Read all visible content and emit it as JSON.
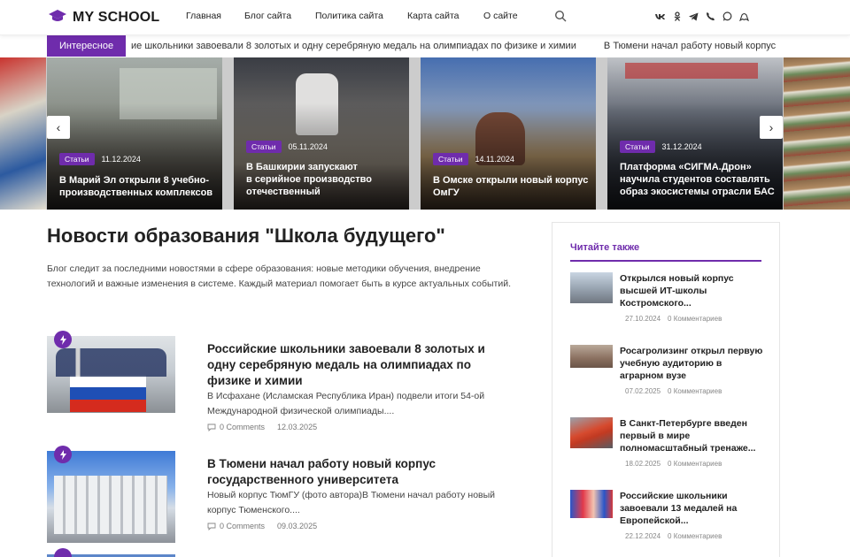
{
  "header": {
    "logo_text": "MY SCHOOL",
    "nav": [
      "Главная",
      "Блог сайта",
      "Политика сайта",
      "Карта сайта",
      "О сайте"
    ],
    "socials": [
      "vk-icon",
      "odnoklassniki-icon",
      "telegram-icon",
      "viber-icon",
      "whatsapp-icon",
      "max-icon"
    ]
  },
  "ticker": {
    "badge": "Интересное",
    "items": [
      "ие школьники завоевали 8 золотых и одну серебряную медаль на олимпиадах по физике и химии",
      "В Тюмени начал работу новый корпус"
    ]
  },
  "slider": {
    "slides": [
      {
        "category": "Статьи",
        "date": "11.12.2024",
        "title_lines": [
          "В Марий Эл открыли 8 учебно-",
          "производственных комплексов"
        ]
      },
      {
        "category": "Статьи",
        "date": "05.11.2024",
        "title_lines": [
          "В Башкирии запускают",
          "в серийное производство",
          "отечественный"
        ]
      },
      {
        "category": "Статьи",
        "date": "14.11.2024",
        "title_lines": [
          "В Омске открыли новый корпус",
          "ОмГУ"
        ]
      },
      {
        "category": "Статьи",
        "date": "31.12.2024",
        "title_lines": [
          "Платформа «СИГМА.Дрон»",
          "научила студентов составлять",
          "образ экосистемы отрасли БАС"
        ]
      }
    ]
  },
  "main": {
    "title": "Новости образования \"Школа будущего\"",
    "intro": "Блог следит за последними новостями в сфере образования: новые методики обучения, внедрение технологий и важные изменения в системе. Каждый материал помогает быть в курсе актуальных событий.",
    "posts": [
      {
        "title": "Российские школьники завоевали 8 золотых и одну серебряную медаль на олимпиадах по физике и химии",
        "excerpt": "В Исфахане (Исламская Республика Иран) подвели итоги 54-ой Международной физической олимпиады....",
        "comments": "0 Comments",
        "date": "12.03.2025"
      },
      {
        "title": "В Тюмени начал работу новый корпус государственного университета",
        "excerpt": "Новый корпус ТюмГУ (фото автора)В Тюмени начал работу новый корпус Тюменского....",
        "comments": "0 Comments",
        "date": "09.03.2025"
      }
    ]
  },
  "sidebar": {
    "title": "Читайте также",
    "items": [
      {
        "title": "Открылся новый корпус высшей ИТ-школы Костромского...",
        "date": "27.10.2024",
        "comments": "0 Комментариев"
      },
      {
        "title": "Росагролизинг открыл первую учебную аудиторию в аграрном вузе",
        "date": "07.02.2025",
        "comments": "0 Комментариев"
      },
      {
        "title": "В Санкт-Петербурге введен первый в мире полномасштабный тренаже...",
        "date": "18.02.2025",
        "comments": "0 Комментариев"
      },
      {
        "title": "Российские школьники завоевали 13 медалей на Европейской...",
        "date": "22.12.2024",
        "comments": "0 Комментариев"
      }
    ]
  },
  "colors": {
    "accent": "#6f2cac"
  }
}
